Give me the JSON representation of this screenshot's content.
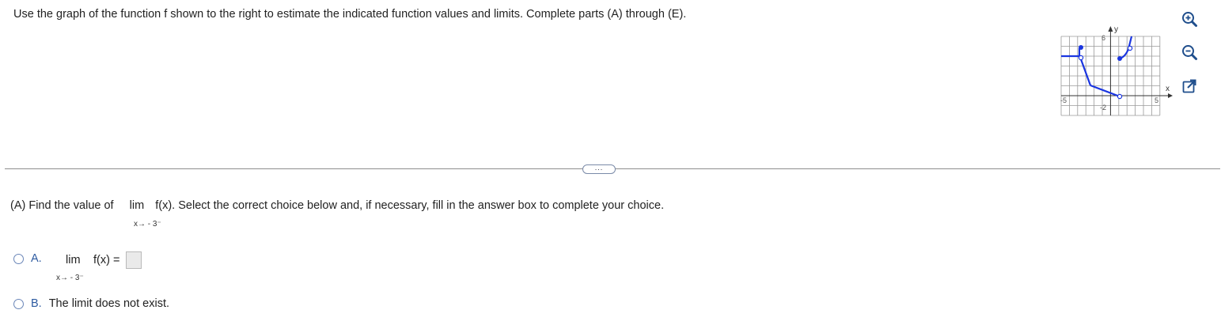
{
  "instructions": "Use the graph of the function f shown to the right to estimate the indicated function values and limits. Complete parts (A) through (E).",
  "graph": {
    "y_label": "y",
    "x_label": "x",
    "tick_y_top": "6",
    "tick_y_bottom": "-2",
    "tick_x_left": "-5",
    "tick_x_right": "5",
    "line_color": "#1a35e0"
  },
  "toolbar": {
    "zoom_in": "zoom-in",
    "zoom_out": "zoom-out",
    "popout": "open-in-new-window"
  },
  "more_button": "...",
  "part_a": {
    "prefix": "(A) Find the value of",
    "lim": "lim",
    "expr": "f(x).",
    "sub": "x→ - 3⁻",
    "suffix": "Select the correct choice below and, if necessary, fill in the answer box to complete your choice."
  },
  "choices": {
    "a": {
      "letter": "A.",
      "lim": "lim",
      "expr": "f(x) =",
      "sub": "x→ - 3⁻",
      "answer_value": ""
    },
    "b": {
      "letter": "B.",
      "text": "The limit does not exist."
    }
  }
}
